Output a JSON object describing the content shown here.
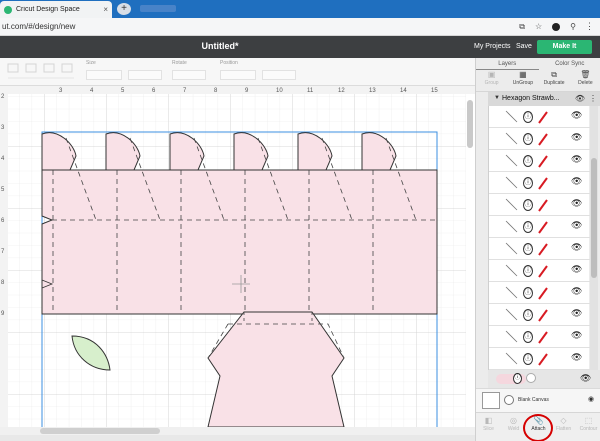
{
  "browser": {
    "tab_title": "Cricut Design Space",
    "tab_close": "×",
    "new_tab": "+",
    "url": "ut.com/#/design/new",
    "ext_icons": [
      "⧉",
      "☆",
      "⚲"
    ],
    "menu": "⋮"
  },
  "header": {
    "title": "Untitled*",
    "my_projects": "My Projects",
    "save": "Save",
    "make_it": "Make It"
  },
  "toolbar": {
    "labels": [
      "Size",
      "Rotate",
      "Position"
    ]
  },
  "ruler": {
    "top_numbers": [
      "3",
      "4",
      "5",
      "6",
      "7",
      "8",
      "9",
      "10",
      "11",
      "12",
      "13",
      "14",
      "15"
    ],
    "left_numbers": [
      "2",
      "3",
      "4",
      "5",
      "6",
      "7",
      "8",
      "9"
    ]
  },
  "panel": {
    "tabs": [
      "Layers",
      "Color Sync"
    ],
    "actions": [
      {
        "label": "Group",
        "icon": "▣",
        "active": false
      },
      {
        "label": "UnGroup",
        "icon": "▦",
        "active": true
      },
      {
        "label": "Duplicate",
        "icon": "⧉",
        "active": true
      },
      {
        "label": "Delete",
        "icon": "🗑",
        "active": true
      }
    ],
    "group_name": "Hexagon Strawb...",
    "group_caret": "▼",
    "eye": "👁",
    "more": "⋮",
    "score_glyph": "ⓘ",
    "layer_rows": 12,
    "blank_canvas": "Blank Canvas",
    "bottom_actions": [
      {
        "label": "Slice",
        "icon": "◧",
        "active": false
      },
      {
        "label": "Weld",
        "icon": "◎",
        "active": false
      },
      {
        "label": "Attach",
        "icon": "📎",
        "active": true
      },
      {
        "label": "Flatten",
        "icon": "◇",
        "active": false
      },
      {
        "label": "Contour",
        "icon": "⬚",
        "active": false
      }
    ]
  },
  "colors": {
    "accent": "#2bb673",
    "shape_fill": "#f9e1e7",
    "leaf_fill": "#d7efcc",
    "annotation": "#d50000"
  }
}
